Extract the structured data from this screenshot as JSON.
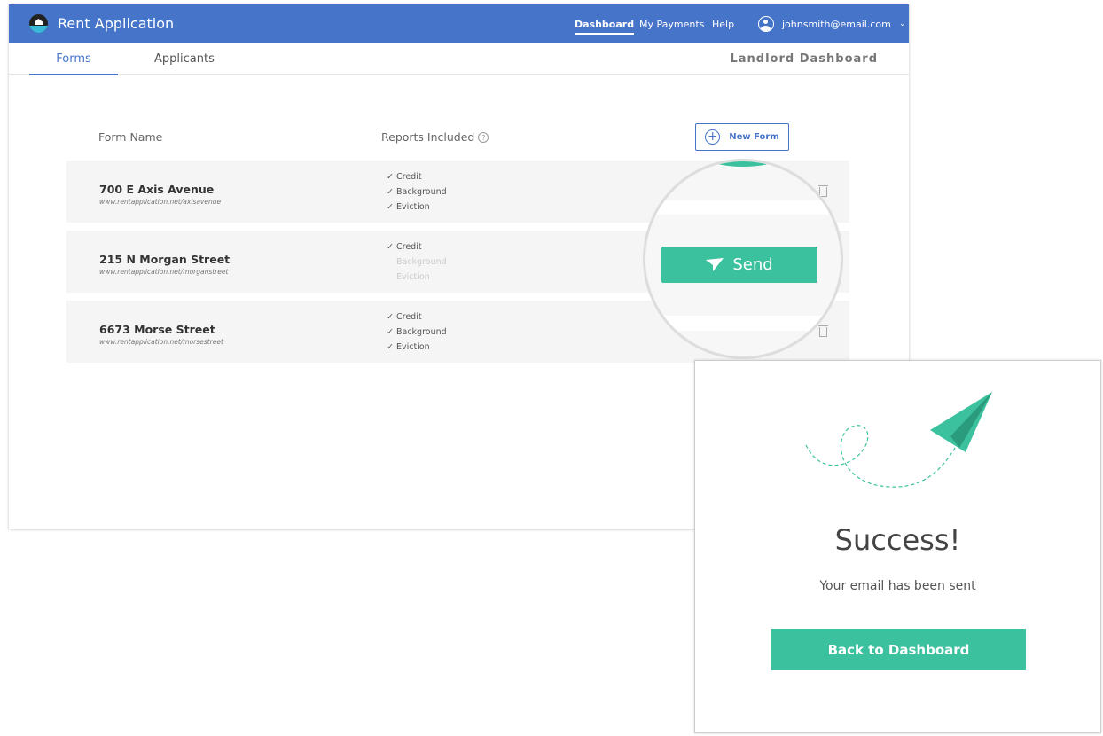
{
  "header": {
    "title": "Rent Application",
    "nav": [
      "Dashboard",
      "My Payments",
      "Help"
    ],
    "user": "johnsmith@email.com"
  },
  "tabs": [
    "Forms",
    "Applicants"
  ],
  "section_title": "Landlord Dashboard",
  "table": {
    "col_name": "Form Name",
    "col_reports": "Reports Included",
    "new_form": "New Form",
    "rows": [
      {
        "name": "700 E Axis Avenue",
        "url": "www.rentapplication.net/axisavenue",
        "reports": [
          {
            "label": "Credit",
            "on": true
          },
          {
            "label": "Background",
            "on": true
          },
          {
            "label": "Eviction",
            "on": true
          }
        ]
      },
      {
        "name": "215 N Morgan Street",
        "url": "www.rentapplication.net/morganstreet",
        "reports": [
          {
            "label": "Credit",
            "on": true
          },
          {
            "label": "Background",
            "on": false
          },
          {
            "label": "Eviction",
            "on": false
          }
        ]
      },
      {
        "name": "6673 Morse Street",
        "url": "www.rentapplication.net/morsestreet",
        "reports": [
          {
            "label": "Credit",
            "on": true
          },
          {
            "label": "Background",
            "on": true
          },
          {
            "label": "Eviction",
            "on": true
          }
        ]
      }
    ]
  },
  "send_label": "Send",
  "success": {
    "title": "Success!",
    "message": "Your email has been sent",
    "button": "Back to Dashboard"
  },
  "colors": {
    "primary": "#4674c9",
    "accent": "#3cc19e"
  }
}
